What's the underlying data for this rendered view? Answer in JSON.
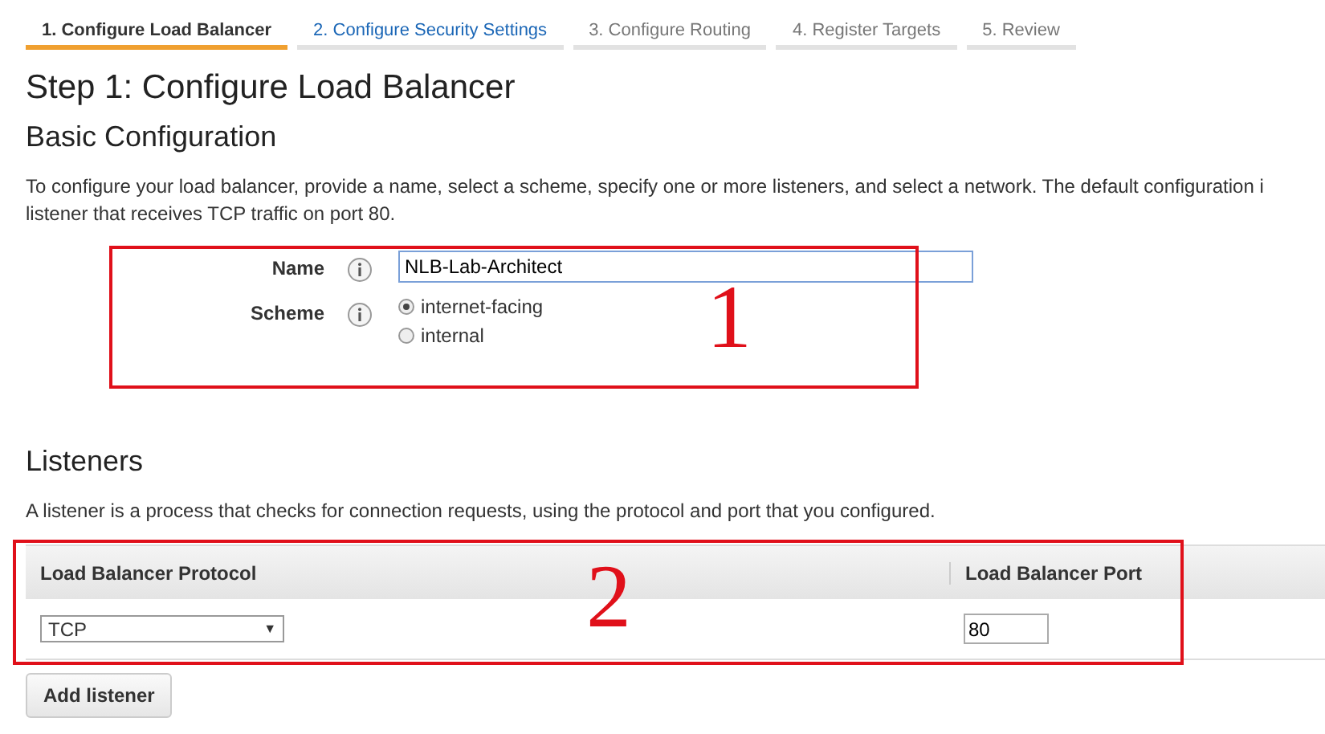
{
  "steps": [
    {
      "label": "1. Configure Load Balancer",
      "selected": true,
      "kind": "current"
    },
    {
      "label": "2. Configure Security Settings",
      "selected": false,
      "kind": "link"
    },
    {
      "label": "3. Configure Routing",
      "selected": false,
      "kind": "pending"
    },
    {
      "label": "4. Register Targets",
      "selected": false,
      "kind": "pending"
    },
    {
      "label": "5. Review",
      "selected": false,
      "kind": "pending"
    }
  ],
  "title": "Step 1: Configure Load Balancer",
  "basic": {
    "heading": "Basic Configuration",
    "description": "To configure your load balancer, provide a name, select a scheme, specify one or more listeners, and select a network. The default configuration i\nlistener that receives TCP traffic on port 80.",
    "name_label": "Name",
    "name_value": "NLB-Lab-Architect",
    "scheme_label": "Scheme",
    "schemes": [
      {
        "label": "internet-facing",
        "selected": true
      },
      {
        "label": "internal",
        "selected": false
      }
    ]
  },
  "listeners": {
    "heading": "Listeners",
    "description": "A listener is a process that checks for connection requests, using the protocol and port that you configured.",
    "columns": [
      "Load Balancer Protocol",
      "Load Balancer Port"
    ],
    "rows": [
      {
        "protocol": "TCP",
        "caret": "▼",
        "port": "80"
      }
    ],
    "add_button": "Add listener"
  },
  "annotations": [
    {
      "label": "1"
    },
    {
      "label": "2"
    }
  ]
}
